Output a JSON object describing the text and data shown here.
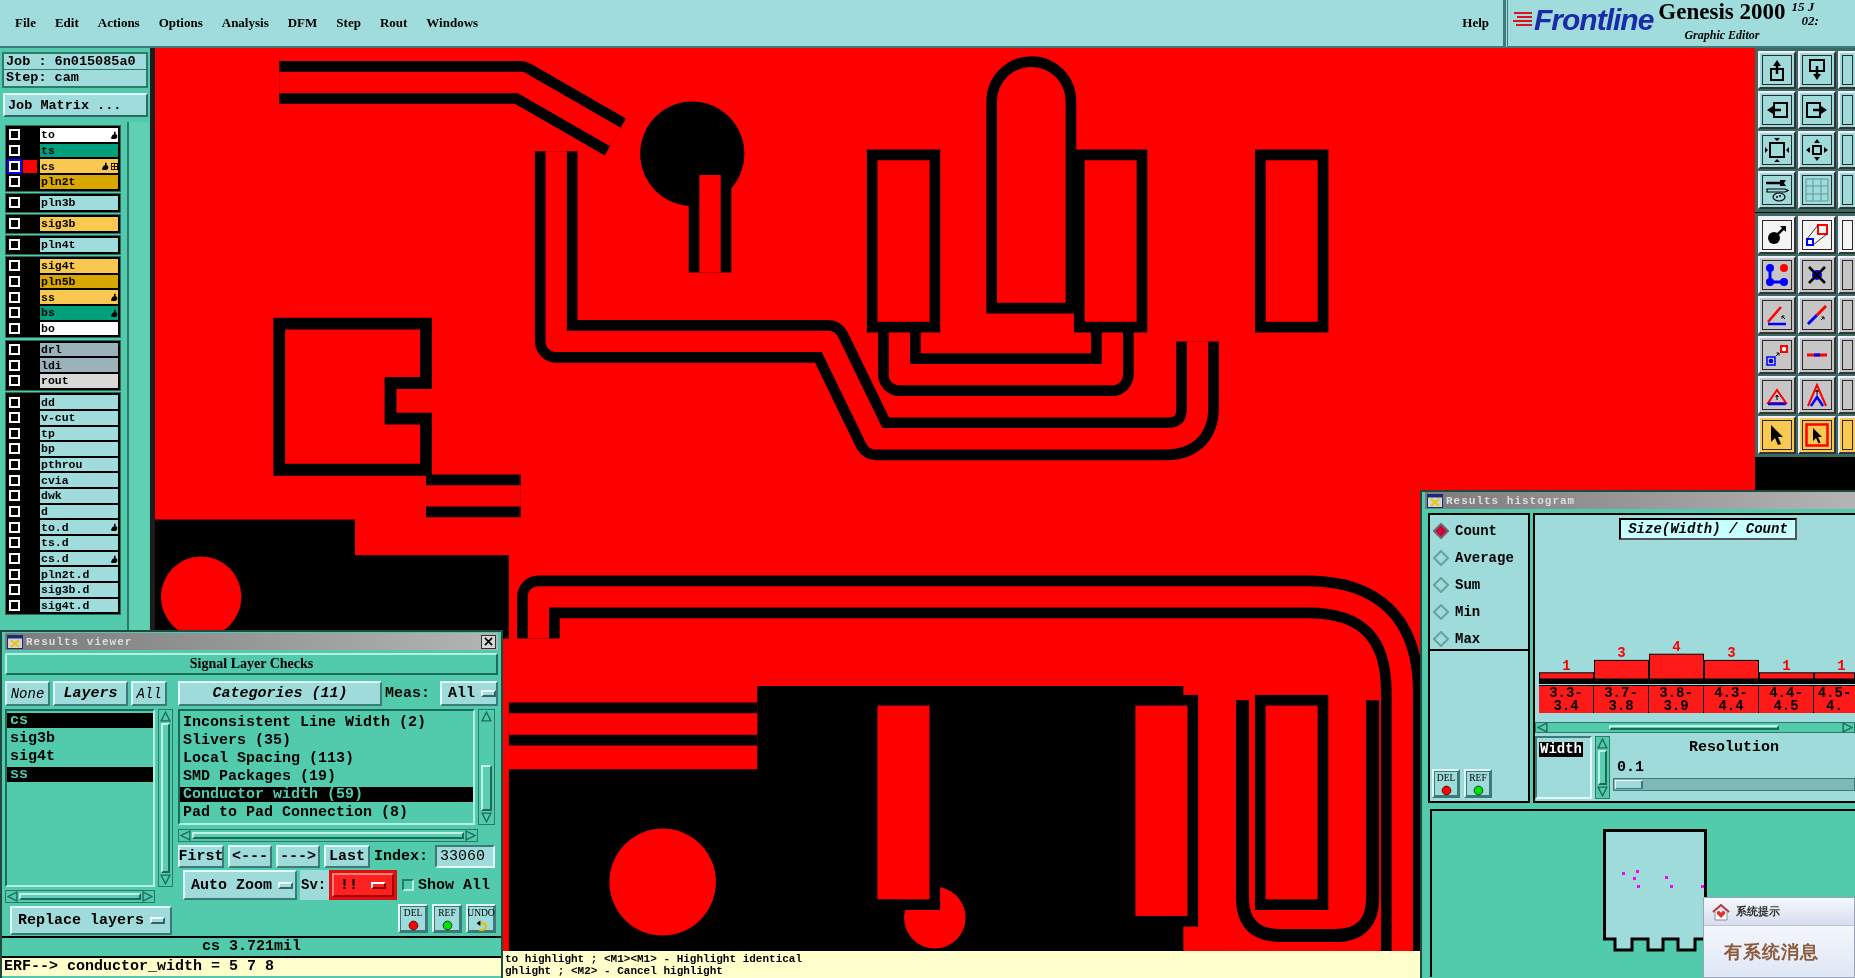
{
  "menu_bar": {
    "items": [
      "File",
      "Edit",
      "Actions",
      "Options",
      "Analysis",
      "DFM",
      "Step",
      "Rout",
      "Windows"
    ],
    "help": "Help"
  },
  "brand": {
    "logo": "Frontline",
    "product": "Genesis 2000",
    "subtitle": "Graphic Editor",
    "date": "15 J",
    "time": "02:"
  },
  "job": {
    "job_line": "Job : 6n015085a0",
    "step_line": "Step: cam",
    "matrix_button": "Job Matrix ..."
  },
  "layer_groups": [
    {
      "layers": [
        {
          "name": "to",
          "color": "#ffffff",
          "checked": false,
          "selected": false,
          "marked": true,
          "extra_mark": false
        },
        {
          "name": "ts",
          "color": "#00a07c",
          "checked": false,
          "selected": false,
          "marked": false,
          "extra_mark": false
        },
        {
          "name": "cs",
          "color": "#f8c850",
          "checked": false,
          "selected": true,
          "marked": true,
          "extra_mark": true
        },
        {
          "name": "pln2t",
          "color": "#d8a800",
          "checked": false,
          "selected": false,
          "marked": false,
          "extra_mark": false
        }
      ]
    },
    {
      "layers": [
        {
          "name": "pln3b",
          "color": "#a0dcdc",
          "checked": false,
          "selected": false,
          "marked": false,
          "extra_mark": false
        }
      ]
    },
    {
      "layers": [
        {
          "name": "sig3b",
          "color": "#f8c850",
          "checked": false,
          "selected": false,
          "marked": false,
          "extra_mark": false
        }
      ]
    },
    {
      "layers": [
        {
          "name": "pln4t",
          "color": "#a0dcdc",
          "checked": false,
          "selected": false,
          "marked": false,
          "extra_mark": false
        }
      ]
    },
    {
      "layers": [
        {
          "name": "sig4t",
          "color": "#f8c850",
          "checked": false,
          "selected": false,
          "marked": false,
          "extra_mark": false
        },
        {
          "name": "pln5b",
          "color": "#d8a800",
          "checked": false,
          "selected": false,
          "marked": false,
          "extra_mark": false
        },
        {
          "name": "ss",
          "color": "#f8c850",
          "checked": false,
          "selected": false,
          "marked": true,
          "extra_mark": false
        },
        {
          "name": "bs",
          "color": "#00a07c",
          "checked": false,
          "selected": false,
          "marked": true,
          "extra_mark": false
        },
        {
          "name": "bo",
          "color": "#ffffff",
          "checked": false,
          "selected": false,
          "marked": false,
          "extra_mark": false
        }
      ]
    },
    {
      "layers": [
        {
          "name": "drl",
          "color": "#9cb2ba",
          "checked": false,
          "selected": false,
          "marked": false,
          "extra_mark": false
        },
        {
          "name": "ldi",
          "color": "#9cb2ba",
          "checked": false,
          "selected": false,
          "marked": false,
          "extra_mark": false
        },
        {
          "name": "rout",
          "color": "#d8d8d8",
          "checked": false,
          "selected": false,
          "marked": false,
          "extra_mark": false
        }
      ]
    },
    {
      "layers": [
        {
          "name": "dd",
          "color": "#a0dcdc",
          "checked": false,
          "selected": false,
          "marked": false,
          "extra_mark": false
        },
        {
          "name": "v-cut",
          "color": "#a0dcdc",
          "checked": false,
          "selected": false,
          "marked": false,
          "extra_mark": false
        },
        {
          "name": "tp",
          "color": "#a0dcdc",
          "checked": false,
          "selected": false,
          "marked": false,
          "extra_mark": false
        },
        {
          "name": "bp",
          "color": "#a0dcdc",
          "checked": false,
          "selected": false,
          "marked": false,
          "extra_mark": false
        },
        {
          "name": "pthrou",
          "color": "#a0dcdc",
          "checked": false,
          "selected": false,
          "marked": false,
          "extra_mark": false
        },
        {
          "name": "cvia",
          "color": "#a0dcdc",
          "checked": false,
          "selected": false,
          "marked": false,
          "extra_mark": false
        },
        {
          "name": "dwk",
          "color": "#a0dcdc",
          "checked": false,
          "selected": false,
          "marked": false,
          "extra_mark": false
        },
        {
          "name": "d",
          "color": "#a0dcdc",
          "checked": false,
          "selected": false,
          "marked": false,
          "extra_mark": false
        },
        {
          "name": "to.d",
          "color": "#a0dcdc",
          "checked": false,
          "selected": false,
          "marked": true,
          "extra_mark": false
        },
        {
          "name": "ts.d",
          "color": "#a0dcdc",
          "checked": false,
          "selected": false,
          "marked": false,
          "extra_mark": false
        },
        {
          "name": "cs.d",
          "color": "#a0dcdc",
          "checked": false,
          "selected": false,
          "marked": true,
          "extra_mark": false
        },
        {
          "name": "pln2t.d",
          "color": "#a0dcdc",
          "checked": false,
          "selected": false,
          "marked": false,
          "extra_mark": false
        },
        {
          "name": "sig3b.d",
          "color": "#a0dcdc",
          "checked": false,
          "selected": false,
          "marked": false,
          "extra_mark": false
        },
        {
          "name": "sig4t.d",
          "color": "#a0dcdc",
          "checked": false,
          "selected": false,
          "marked": false,
          "extra_mark": false
        }
      ]
    }
  ],
  "results_viewer": {
    "title": "Results viewer",
    "header": "Signal Layer Checks",
    "none_button": "None",
    "layers_label": "Layers",
    "all_button": "All",
    "layers": [
      {
        "name": "cs",
        "selected": true
      },
      {
        "name": "sig3b",
        "selected": false
      },
      {
        "name": "sig4t",
        "selected": false
      },
      {
        "name": "ss",
        "selected": true
      }
    ],
    "replace_mode": "Replace layers",
    "categories_button": "Categories (11)",
    "meas_label": "Meas:",
    "meas_value": "All",
    "categories": [
      {
        "label": "Inconsistent Line Width (2)",
        "selected": false
      },
      {
        "label": "Slivers (35)",
        "selected": false
      },
      {
        "label": "Local Spacing (113)",
        "selected": false
      },
      {
        "label": "SMD Packages (19)",
        "selected": false
      },
      {
        "label": "Conductor width (59)",
        "selected": true
      },
      {
        "label": "Pad to Pad Connection (8)",
        "selected": false
      }
    ],
    "nav_buttons": [
      "First",
      "<---",
      "--->",
      "Last"
    ],
    "index_label": "Index:",
    "index_value": "33060",
    "zoom_mode": "Auto Zoom",
    "severity_label": "Sv:",
    "severity_value": "!!",
    "show_all": {
      "label": "Show All",
      "checked": false
    },
    "actions": [
      {
        "kind": "delete",
        "label": "DEL"
      },
      {
        "kind": "refresh",
        "label": "REF"
      },
      {
        "kind": "undo",
        "label": "UNDO"
      }
    ],
    "status": "cs 3.721mil",
    "command": "ERF--> conductor_width = 5 7 8"
  },
  "histogram": {
    "title": "Results histogram",
    "modes": [
      {
        "label": "Count",
        "selected": true
      },
      {
        "label": "Average",
        "selected": false
      },
      {
        "label": "Sum",
        "selected": false
      },
      {
        "label": "Min",
        "selected": false
      },
      {
        "label": "Max",
        "selected": false
      }
    ],
    "actions": [
      {
        "kind": "delete",
        "label": "DEL"
      },
      {
        "kind": "refresh",
        "label": "REF"
      }
    ],
    "chart_data": {
      "type": "bar",
      "title": "Size(Width) / Count",
      "categories": [
        "3.3-3.4",
        "3.7-3.8",
        "3.8-3.9",
        "4.3-4.4",
        "4.4-4.5",
        "4.5-4."
      ],
      "values": [
        1,
        3,
        4,
        3,
        1,
        1
      ],
      "data_labels": true
    },
    "fields": [
      {
        "label": "Width",
        "selected": true
      }
    ],
    "resolution_label": "Resolution",
    "resolution_value": "0.1",
    "resolution_slider": {
      "level": 0
    }
  },
  "notification": {
    "title": "系统提示",
    "message": "有系统消息"
  },
  "message_bar": {
    "lines": [
      "to highlight ; <M1><M1> - Highlight identical",
      "ghlight ; <M2> - Cancel highlight"
    ]
  }
}
